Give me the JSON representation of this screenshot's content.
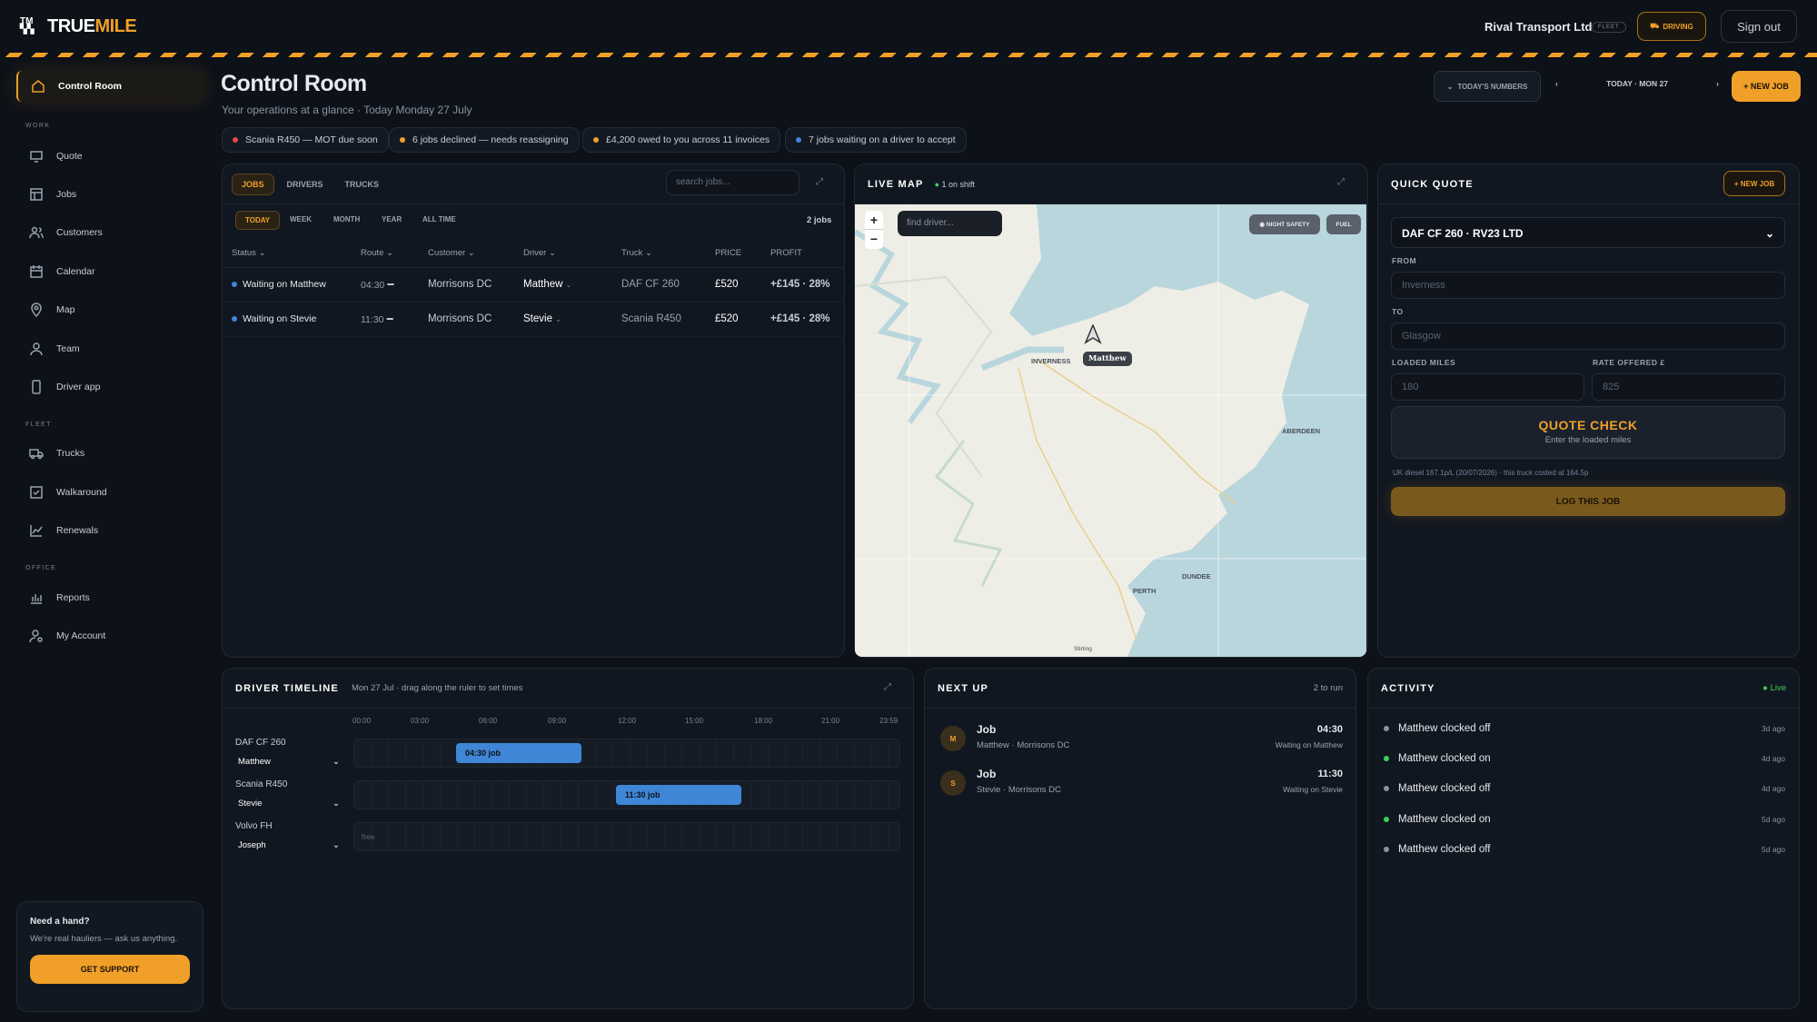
{
  "brand": {
    "mark": "TM",
    "name_a": "TRUE",
    "name_b": "MILE"
  },
  "header": {
    "company": "Rival Transport Ltd",
    "company_badge": "FLEET",
    "driving_label": "DRIVING",
    "signout_label": "Sign out"
  },
  "sidebar": {
    "control_room": "Control Room",
    "sec_work": "WORK",
    "quote": "Quote",
    "jobs": "Jobs",
    "customers": "Customers",
    "calendar": "Calendar",
    "map": "Map",
    "team": "Team",
    "driver_app": "Driver app",
    "sec_fleet": "FLEET",
    "trucks": "Trucks",
    "walkaround": "Walkaround",
    "renewals": "Renewals",
    "sec_office": "OFFICE",
    "reports": "Reports",
    "my_account": "My Account"
  },
  "help": {
    "title": "Need a hand?",
    "text": "We're real hauliers — ask us anything.",
    "button": "GET SUPPORT"
  },
  "page": {
    "title": "Control Room",
    "subtitle": "Your operations at a glance · Today Monday 27 July",
    "numbers_btn": "TODAY'S NUMBERS",
    "prev": "‹",
    "date": "TODAY · MON 27",
    "next": "›",
    "new_job": "+ NEW JOB"
  },
  "alerts": [
    {
      "text": "Scania R450 — MOT due soon",
      "color": "#e5484d"
    },
    {
      "text": "6 jobs declined — needs reassigning",
      "color": "#f0a028"
    },
    {
      "text": "£4,200 owed to you across 11 invoices",
      "color": "#f0a028"
    },
    {
      "text": "7 jobs waiting on a driver to accept",
      "color": "#3f86d6"
    }
  ],
  "jobs_panel": {
    "tabs": [
      "JOBS",
      "DRIVERS",
      "TRUCKS"
    ],
    "search_placeholder": "search jobs...",
    "filters": [
      "TODAY",
      "WEEK",
      "MONTH",
      "YEAR",
      "ALL TIME"
    ],
    "count": "2 jobs",
    "columns": [
      "Status ⌄",
      "Route ⌄",
      "Customer ⌄",
      "Driver ⌄",
      "Truck ⌄",
      "PRICE",
      "PROFIT"
    ],
    "rows": [
      {
        "status": "Waiting on Matthew",
        "time": "04:30",
        "customer": "Morrisons DC",
        "driver": "Matthew",
        "truck": "DAF CF 260",
        "price": "£520",
        "profit": "+£145 · 28%"
      },
      {
        "status": "Waiting on Stevie",
        "time": "11:30",
        "customer": "Morrisons DC",
        "driver": "Stevie",
        "truck": "Scania R450",
        "price": "£520",
        "profit": "+£145 · 28%"
      }
    ]
  },
  "live_map": {
    "title": "LIVE MAP",
    "shift": "1 on shift",
    "find_placeholder": "find driver...",
    "zoom_in": "+",
    "zoom_out": "−",
    "tag_safety": "NIGHT SAFETY",
    "tag_fuel": "FUEL",
    "places": {
      "inverness": "INVERNESS",
      "aberdeen": "ABERDEEN",
      "dundee": "DUNDEE",
      "perth": "PERTH",
      "stirling": "Stirling"
    },
    "marker": "Matthew"
  },
  "quick_quote": {
    "title": "QUICK QUOTE",
    "new_job": "+ NEW JOB",
    "truck": "DAF CF 260 · RV23 LTD",
    "from_label": "FROM",
    "from_placeholder": "Inverness",
    "to_label": "TO",
    "to_placeholder": "Glasgow",
    "miles_label": "LOADED MILES",
    "miles_placeholder": "180",
    "rate_label": "RATE OFFERED £",
    "rate_placeholder": "825",
    "check_title": "QUOTE CHECK",
    "check_sub": "Enter the loaded miles",
    "diesel_note": "UK diesel 167.1p/L (20/07/2026) · this truck costed at 164.5p",
    "log_btn": "LOG THIS JOB"
  },
  "timeline": {
    "title": "DRIVER TIMELINE",
    "subtitle": "Mon 27 Jul · drag along the ruler to set times",
    "hours": [
      "00:00",
      "03:00",
      "06:00",
      "09:00",
      "12:00",
      "15:00",
      "18:00",
      "21:00",
      "23:59"
    ],
    "rows": [
      {
        "truck": "DAF CF 260",
        "driver": "Matthew",
        "bar": "04:30 job"
      },
      {
        "truck": "Scania R450",
        "driver": "Stevie",
        "bar": "11:30 job"
      },
      {
        "truck": "Volvo FH",
        "driver": "Joseph",
        "free": "free"
      }
    ]
  },
  "next_up": {
    "title": "NEXT UP",
    "count": "2 to run",
    "items": [
      {
        "initial": "M",
        "title": "Job",
        "sub": "Matthew · Morrisons DC",
        "time": "04:30",
        "status": "Waiting on Matthew"
      },
      {
        "initial": "S",
        "title": "Job",
        "sub": "Stevie · Morrisons DC",
        "time": "11:30",
        "status": "Waiting on Stevie"
      }
    ]
  },
  "activity": {
    "title": "ACTIVITY",
    "live": "Live",
    "items": [
      {
        "text": "Matthew clocked off",
        "time": "3d ago",
        "color": "#8a93a3"
      },
      {
        "text": "Matthew clocked on",
        "time": "4d ago",
        "color": "#3ecf5c"
      },
      {
        "text": "Matthew clocked off",
        "time": "4d ago",
        "color": "#8a93a3"
      },
      {
        "text": "Matthew clocked on",
        "time": "5d ago",
        "color": "#3ecf5c"
      },
      {
        "text": "Matthew clocked off",
        "time": "5d ago",
        "color": "#8a93a3"
      }
    ]
  }
}
